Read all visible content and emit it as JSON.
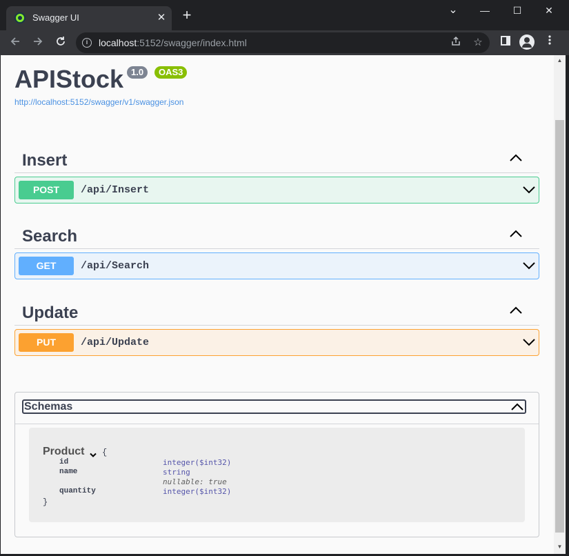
{
  "browser": {
    "tab_title": "Swagger UI",
    "tab_close": "✕",
    "new_tab": "+",
    "window_controls": {
      "minimize": "—",
      "maximize": "☐",
      "close": "✕",
      "tab_search": "⌄"
    },
    "url_host": "localhost",
    "url_rest": ":5152/swagger/index.html",
    "icons": [
      "back-arrow-icon",
      "forward-arrow-icon",
      "reload-icon",
      "info-icon",
      "share-icon",
      "star-icon",
      "side-panel-icon",
      "profile-icon",
      "menu-icon"
    ]
  },
  "page": {
    "title": "APIStock",
    "version_badge": "1.0",
    "oas_badge": "OAS3",
    "spec_url": "http://localhost:5152/swagger/v1/swagger.json",
    "colors": {
      "post": "#49cc90",
      "get": "#61affe",
      "put": "#fca130",
      "oas": "#89bf04",
      "text": "#3b4151"
    }
  },
  "tags": [
    {
      "name": "Insert",
      "method": "POST",
      "path": "/api/Insert"
    },
    {
      "name": "Search",
      "method": "GET",
      "path": "/api/Search"
    },
    {
      "name": "Update",
      "method": "PUT",
      "path": "/api/Update"
    }
  ],
  "schemas": {
    "title": "Schemas",
    "model": {
      "name": "Product",
      "open_brace": "{",
      "close_brace": "}",
      "properties": [
        {
          "name": "id",
          "type": "integer($int32)"
        },
        {
          "name": "name",
          "type": "string",
          "extra": "nullable: true"
        },
        {
          "name": "quantity",
          "type": "integer($int32)"
        }
      ]
    }
  }
}
